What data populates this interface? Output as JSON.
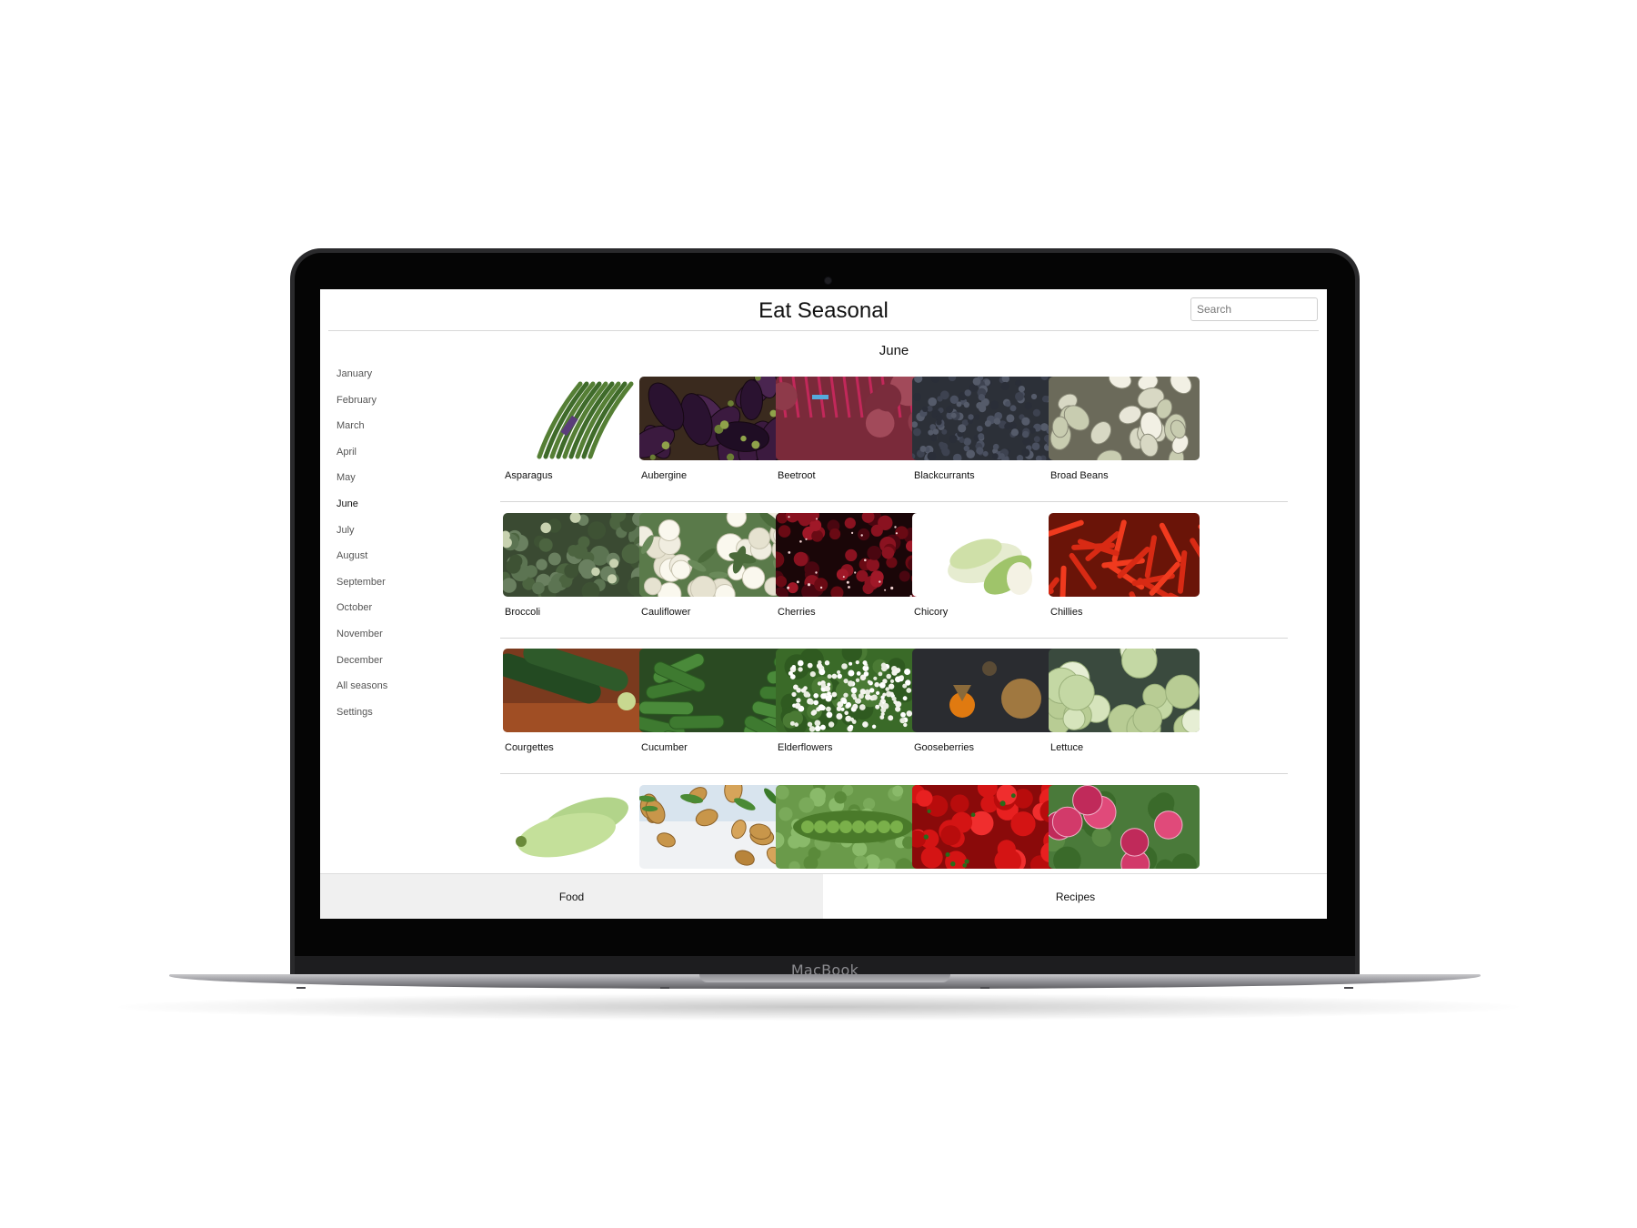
{
  "device": {
    "brand_label": "MacBook"
  },
  "app": {
    "title": "Eat Seasonal",
    "search": {
      "placeholder": "Search",
      "value": ""
    }
  },
  "sidebar": {
    "items": [
      {
        "label": "January"
      },
      {
        "label": "February"
      },
      {
        "label": "March"
      },
      {
        "label": "April"
      },
      {
        "label": "May"
      },
      {
        "label": "June",
        "active": true
      },
      {
        "label": "July"
      },
      {
        "label": "August"
      },
      {
        "label": "September"
      },
      {
        "label": "October"
      },
      {
        "label": "November"
      },
      {
        "label": "December"
      },
      {
        "label": "All seasons"
      },
      {
        "label": "Settings"
      }
    ]
  },
  "main": {
    "month_heading": "June",
    "foods": [
      {
        "label": "Asparagus",
        "kind": "asparagus"
      },
      {
        "label": "Aubergine",
        "kind": "aubergine"
      },
      {
        "label": "Beetroot",
        "kind": "beetroot"
      },
      {
        "label": "Blackcurrants",
        "kind": "blackcurrants"
      },
      {
        "label": "Broad Beans",
        "kind": "broadbeans"
      },
      {
        "label": "Broccoli",
        "kind": "broccoli"
      },
      {
        "label": "Cauliflower",
        "kind": "cauliflower"
      },
      {
        "label": "Cherries",
        "kind": "cherries"
      },
      {
        "label": "Chicory",
        "kind": "chicory"
      },
      {
        "label": "Chillies",
        "kind": "chillies"
      },
      {
        "label": "Courgettes",
        "kind": "courgettes"
      },
      {
        "label": "Cucumber",
        "kind": "cucumber"
      },
      {
        "label": "Elderflowers",
        "kind": "elderflowers"
      },
      {
        "label": "Gooseberries",
        "kind": "gooseberries"
      },
      {
        "label": "Lettuce",
        "kind": "lettuce"
      },
      {
        "label": "",
        "kind": "marrow"
      },
      {
        "label": "",
        "kind": "potatoes"
      },
      {
        "label": "",
        "kind": "peas"
      },
      {
        "label": "",
        "kind": "peppers"
      },
      {
        "label": "",
        "kind": "radishes"
      }
    ]
  },
  "bottom_tabs": [
    {
      "label": "Food",
      "selected": true
    },
    {
      "label": "Recipes",
      "selected": false
    }
  ],
  "colors": {
    "selected_tab_bg": "#f0f0f0",
    "divider": "#d9d9d9"
  }
}
